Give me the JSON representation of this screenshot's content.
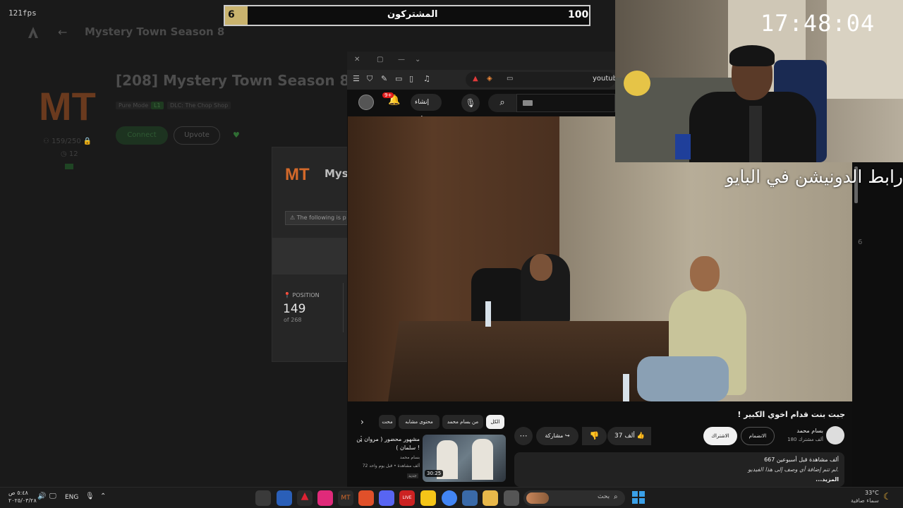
{
  "launcher": {
    "fps": "121fps",
    "header_title": "Mystery Town Season 8",
    "server_title": "[208] Mystery Town Season 8",
    "tag_mode": "Pure Mode",
    "tag_level": "L1",
    "tag_dlc": "DLC: The Chop Shop",
    "connect_label": "Connect",
    "upvote_label": "Upvote",
    "players": "159/250",
    "votes": "12"
  },
  "modal": {
    "title": "Mys",
    "warning": "The following is p",
    "position_label": "POSITION",
    "position_value": "149",
    "position_of": "of 268"
  },
  "subscriber_bar": {
    "current": "6",
    "label": "المشتركون",
    "goal": "100",
    "progress_fraction": 0.06,
    "fill_color": "#c9b36e"
  },
  "browser": {
    "url": "youtub",
    "yt": {
      "notif_count": "9+",
      "create_label": "إنشاء",
      "video_title": "جبت بنت قدام اخوي الكبير !",
      "channel_name": "بسام محمد",
      "channel_subs": "180 ألف مشترك",
      "subscribe_label": "الاشتراك",
      "join_label": "الانضمام",
      "likes": "37 ألف",
      "share_label": "مشاركة",
      "desc_stats": "667 ألف مشاهدة  قبل أسبوعين",
      "desc_text": "لم تتم إضافة أي وصف إلى هذا الفيديو.",
      "desc_more": "...المزيد",
      "chips": {
        "all": "الكل",
        "from_channel": "من بسام محمد",
        "similar": "محتوى مشابه",
        "cut": "محت"
      },
      "rec": {
        "title": "مشهور محضور ( مروان بن سلمان ) !",
        "channel": "بسام محمد",
        "stats": "72 ألف مشاهدة • قبل يوم واحد",
        "badge": "جديد",
        "duration": "30:25"
      }
    }
  },
  "stream": {
    "clock": "17:48:04",
    "overlay_text": "رابط الدونيشن في البايو",
    "side_number": "6"
  },
  "taskbar": {
    "time": "٥:٤٨ ص",
    "date": "٢٠٢٥/٠٣/٢٨",
    "lang": "ENG",
    "search_label": "بحث",
    "weather_temp": "33°C",
    "weather_desc": "سماء صافية"
  }
}
